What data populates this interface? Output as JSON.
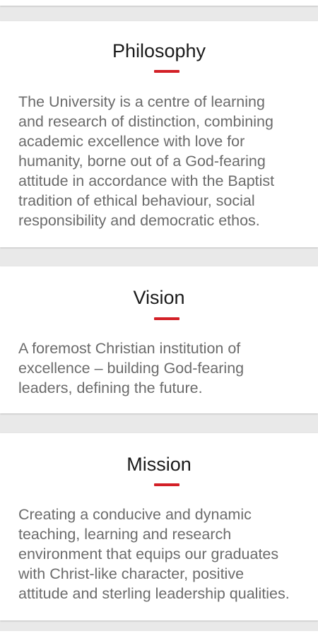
{
  "accent_color": "#d32027",
  "sections": [
    {
      "title": "Philosophy",
      "body": "The University is a centre of learning\nand research of distinction, combining\nacademic excellence with love for\nhumanity, borne out of a God-fearing\nattitude in accordance with the Baptist\ntradition of ethical behaviour, social\nresponsibility and democratic ethos."
    },
    {
      "title": "Vision",
      "body": "A foremost Christian institution of\nexcellence – building God-fearing\nleaders, defining the future."
    },
    {
      "title": "Mission",
      "body": "Creating a conducive and dynamic\nteaching, learning and research\nenvironment that equips our graduates\nwith Christ-like character, positive\nattitude and sterling leadership qualities."
    }
  ]
}
